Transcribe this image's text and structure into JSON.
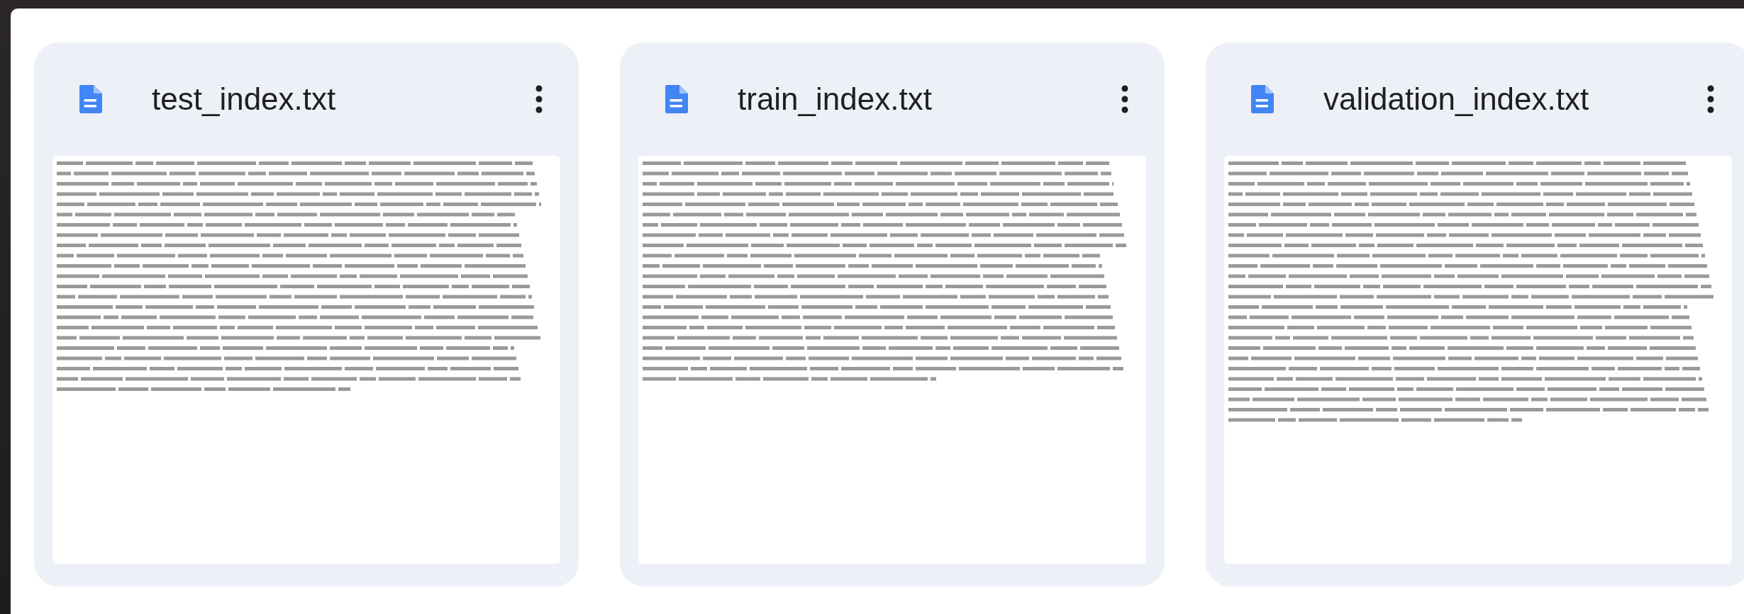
{
  "files": [
    {
      "name": "test_index.txt"
    },
    {
      "name": "train_index.txt"
    },
    {
      "name": "validation_index.txt"
    }
  ]
}
